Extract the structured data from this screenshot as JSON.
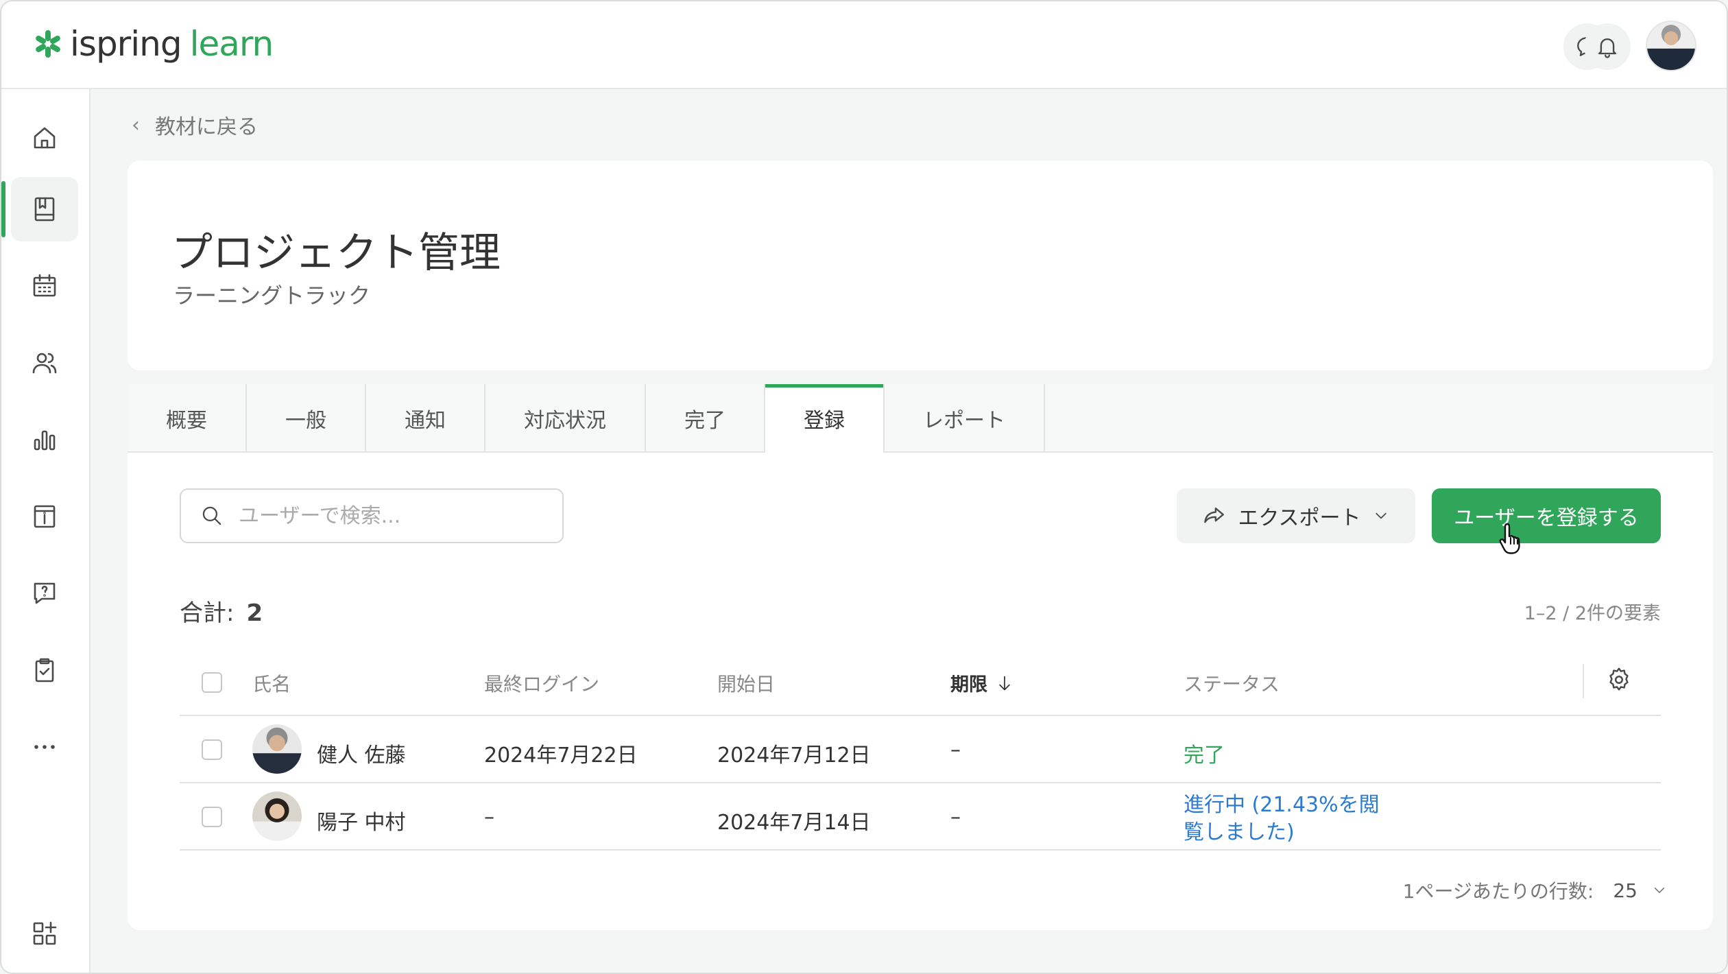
{
  "app": {
    "logo_a": "ispring",
    "logo_b": "learn"
  },
  "nav": {
    "back_label": "教材に戻る"
  },
  "course": {
    "title": "プロジェクト管理",
    "type": "ラーニングトラック"
  },
  "tabs": [
    {
      "label": "概要"
    },
    {
      "label": "一般"
    },
    {
      "label": "通知"
    },
    {
      "label": "対応状況"
    },
    {
      "label": "完了"
    },
    {
      "label": "登録",
      "active": true
    },
    {
      "label": "レポート"
    }
  ],
  "toolbar": {
    "search_placeholder": "ユーザーで検索...",
    "export_label": "エクスポート",
    "register_label": "ユーザーを登録する"
  },
  "summary": {
    "total_label": "合計:",
    "total_value": "2",
    "range_text": "1–2 / 2件の要素"
  },
  "table": {
    "headers": {
      "name": "氏名",
      "last_login": "最終ログイン",
      "start": "開始日",
      "due": "期限",
      "status": "ステータス"
    },
    "rows": [
      {
        "name": "健人 佐藤",
        "last_login": "2024年7月22日",
        "start": "2024年7月12日",
        "due": "–",
        "status": "完了"
      },
      {
        "name": "陽子 中村",
        "last_login": "–",
        "start": "2024年7月14日",
        "due": "–",
        "status": "進行中 (21.43%を閲覧しました)"
      }
    ]
  },
  "pager": {
    "label": "1ページあたりの行数:",
    "value": "25"
  },
  "colors": {
    "accent": "#2fa65a",
    "link": "#2b7bd3"
  },
  "icons": [
    "home-icon",
    "book-icon",
    "calendar-icon",
    "users-icon",
    "chart-icon",
    "info-board-icon",
    "question-chat-icon",
    "clipboard-check-icon",
    "more-icon",
    "apps-add-icon",
    "chat-icon",
    "bell-icon",
    "search-icon",
    "share-icon",
    "chevron-down-icon",
    "sort-down-icon",
    "gear-icon"
  ]
}
